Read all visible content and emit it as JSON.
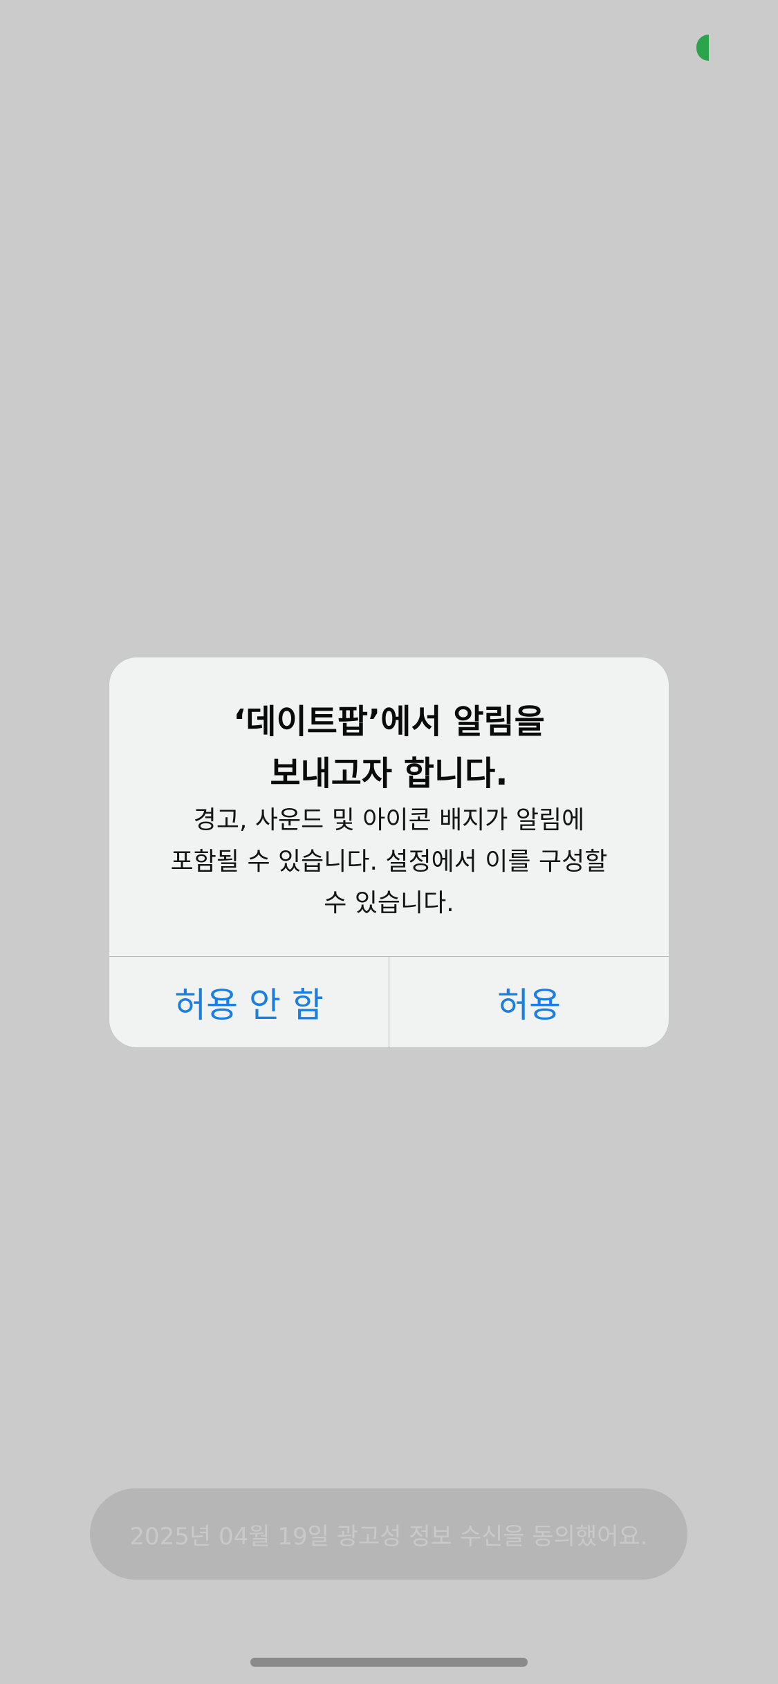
{
  "alert": {
    "title_line1": "‘데이트팝’에서 알림을",
    "title_line2": "보내고자 합니다.",
    "message_line1": "경고, 사운드 및 아이콘 배지가 알림에",
    "message_line2": "포함될 수 있습니다. 설정에서 이를 구성할",
    "message_line3": "수 있습니다.",
    "deny_label": "허용 안 함",
    "allow_label": "허용"
  },
  "toast": {
    "text": "2025년 04월 19일 광고성 정보 수신을 동의했어요."
  },
  "colors": {
    "background": "#cbcbcb",
    "alert_background": "#f1f2f2",
    "button_text": "#1a7fe0",
    "status_green": "#2aa54b"
  }
}
